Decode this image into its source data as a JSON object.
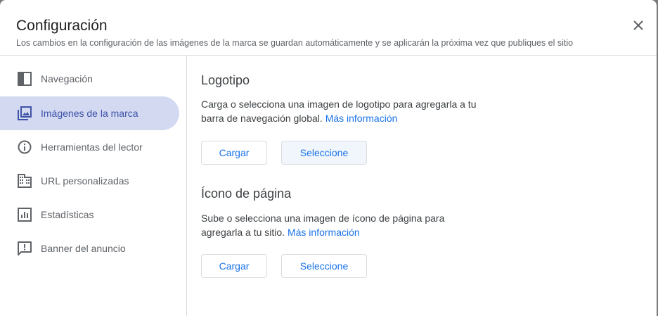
{
  "dialog": {
    "title": "Configuración",
    "subtitle": "Los cambios en la configuración de las imágenes de la marca se guardan automáticamente y se aplicarán la próxima vez que publiques el sitio",
    "close_icon": "close-icon"
  },
  "sidebar": {
    "items": [
      {
        "label": "Navegación",
        "icon": "navigation-panel-icon",
        "active": false
      },
      {
        "label": "Imágenes de la marca",
        "icon": "image-icon",
        "active": true
      },
      {
        "label": "Herramientas del lector",
        "icon": "info-icon",
        "active": false
      },
      {
        "label": "URL personalizadas",
        "icon": "domain-icon",
        "active": false
      },
      {
        "label": "Estadísticas",
        "icon": "analytics-icon",
        "active": false
      },
      {
        "label": "Banner del anuncio",
        "icon": "announcement-icon",
        "active": false
      }
    ]
  },
  "logo": {
    "title": "Logotipo",
    "description": "Carga o selecciona una imagen de logotipo para agregarla a tu barra de navegación global.",
    "link": "Más información",
    "upload_label": "Cargar",
    "select_label": "Seleccione"
  },
  "favicon": {
    "title": "Ícono de página",
    "description": "Sube o selecciona una imagen de ícono de página para agregarla a tu sitio.",
    "link": "Más información",
    "upload_label": "Cargar",
    "select_label": "Seleccione"
  },
  "colors": {
    "accent": "#1a73e8",
    "active_nav_bg": "#d2d9f1",
    "active_nav_text": "#3f53a8"
  }
}
